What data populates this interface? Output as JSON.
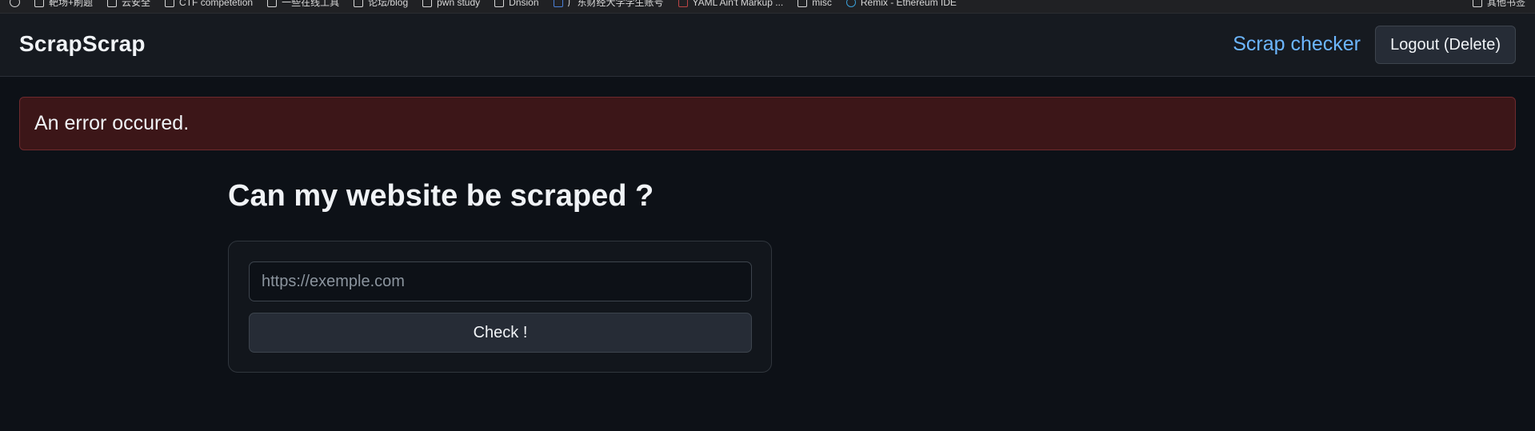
{
  "bookmarks": {
    "items": [
      {
        "label": "靶场+刷题",
        "icon": "folder-icon"
      },
      {
        "label": "云安全",
        "icon": "folder-icon"
      },
      {
        "label": "CTF competetion",
        "icon": "folder-icon"
      },
      {
        "label": "一些在线工具",
        "icon": "folder-icon"
      },
      {
        "label": "论坛/blog",
        "icon": "folder-icon"
      },
      {
        "label": "pwn study",
        "icon": "folder-icon"
      },
      {
        "label": "Dnsion",
        "icon": "folder-icon"
      },
      {
        "label": "广东财经大学学生账号",
        "icon": "site-icon"
      },
      {
        "label": "YAML Ain't Markup ...",
        "icon": "site-icon"
      },
      {
        "label": "misc",
        "icon": "folder-icon"
      },
      {
        "label": "Remix - Ethereum IDE",
        "icon": "site-icon"
      }
    ],
    "other_bookmarks": "其他书签"
  },
  "navbar": {
    "brand": "ScrapScrap",
    "link": "Scrap checker",
    "logout": "Logout (Delete)"
  },
  "alert": {
    "message": "An error occured."
  },
  "main": {
    "title": "Can my website be scraped ?",
    "input_placeholder": "https://exemple.com",
    "input_value": "",
    "submit_label": "Check !"
  },
  "colors": {
    "background": "#0d1117",
    "navbar": "#161a20",
    "link": "#6cb6ff",
    "alert_bg": "#3c1618",
    "alert_border": "#6e2a2e",
    "button_bg": "#262c36"
  }
}
